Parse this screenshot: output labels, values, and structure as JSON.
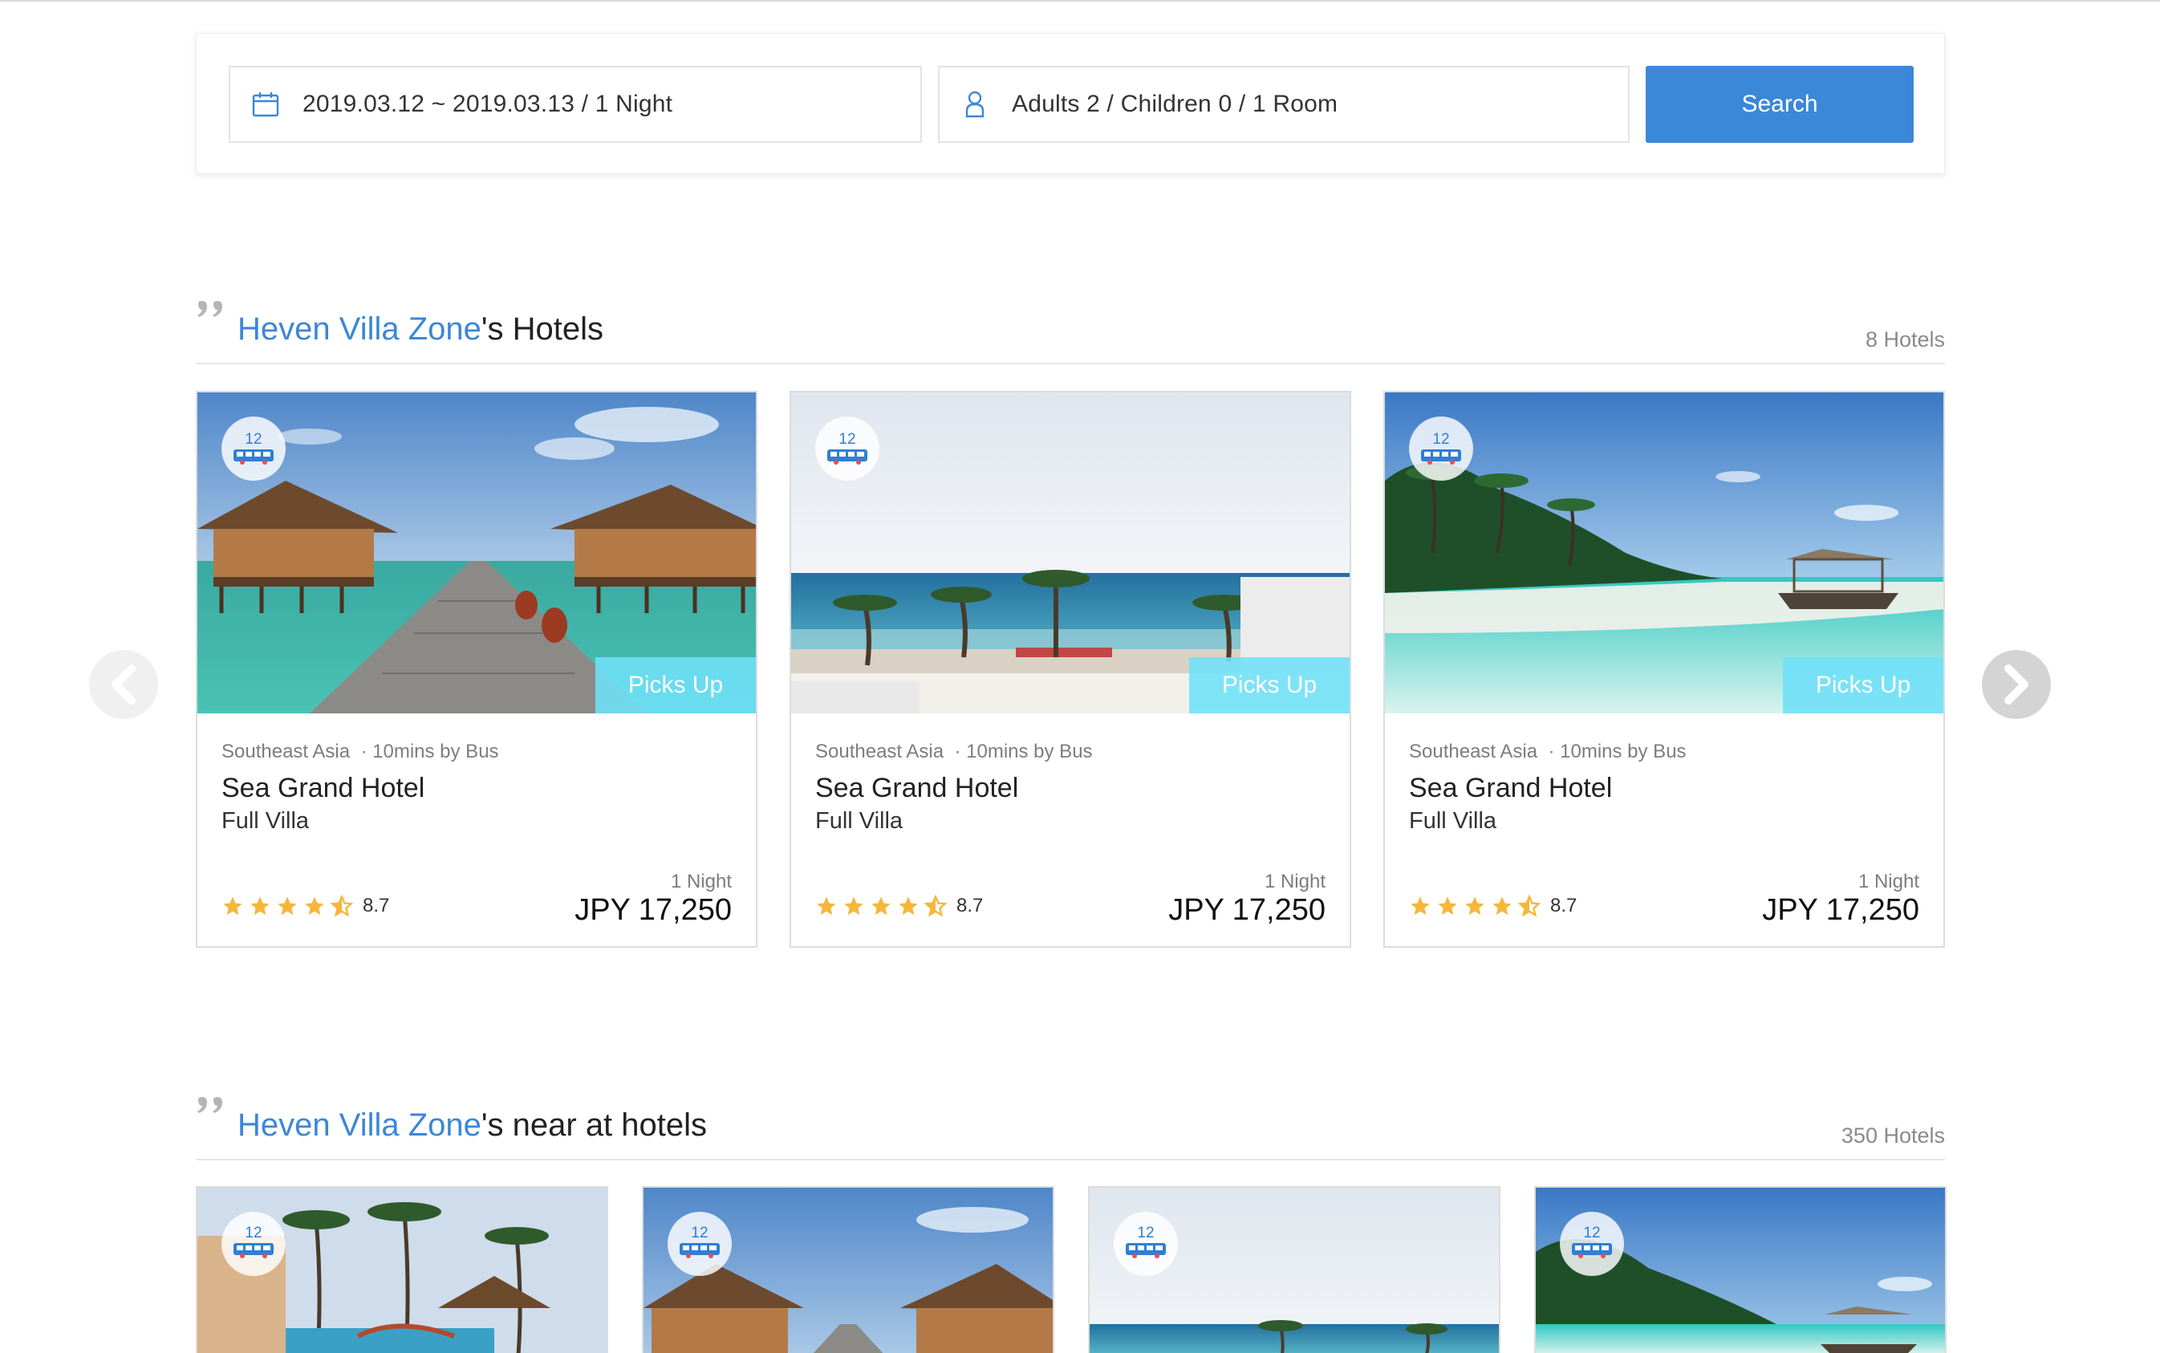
{
  "search": {
    "dates": "2019.03.12 ~ 2019.03.13 / 1 Night",
    "guests": "Adults 2 / Children 0 / 1 Room",
    "button": "Search",
    "calendar_icon": "calendar-icon",
    "person_icon": "person-icon"
  },
  "colors": {
    "accent": "#3b87d8",
    "picks_up": "#6ee0f8",
    "star": "#f5b73b"
  },
  "section_hotels": {
    "zone": "Heven Villa Zone",
    "suffix": "'s Hotels",
    "count": "8 Hotels"
  },
  "section_near": {
    "zone": "Heven Villa Zone",
    "suffix": "'s near at hotels",
    "count": "350 Hotels"
  },
  "hotels": [
    {
      "bus_count": "12",
      "badge": "Picks Up",
      "region": "Southeast Asia",
      "distance": "· 10mins by Bus",
      "name": "Sea Grand Hotel",
      "room_type": "Full Villa",
      "rating": "8.7",
      "stars": 4.5,
      "nights": "1 Night",
      "price": "JPY 17,250"
    },
    {
      "bus_count": "12",
      "badge": "Picks Up",
      "region": "Southeast Asia",
      "distance": "· 10mins by Bus",
      "name": "Sea Grand Hotel",
      "room_type": "Full Villa",
      "rating": "8.7",
      "stars": 4.5,
      "nights": "1 Night",
      "price": "JPY 17,250"
    },
    {
      "bus_count": "12",
      "badge": "Picks Up",
      "region": "Southeast Asia",
      "distance": "· 10mins by Bus",
      "name": "Sea Grand Hotel",
      "room_type": "Full Villa",
      "rating": "8.7",
      "stars": 4.5,
      "nights": "1 Night",
      "price": "JPY 17,250"
    }
  ],
  "near_hotels": [
    {
      "bus_count": "12"
    },
    {
      "bus_count": "12"
    },
    {
      "bus_count": "12"
    },
    {
      "bus_count": "12"
    }
  ]
}
